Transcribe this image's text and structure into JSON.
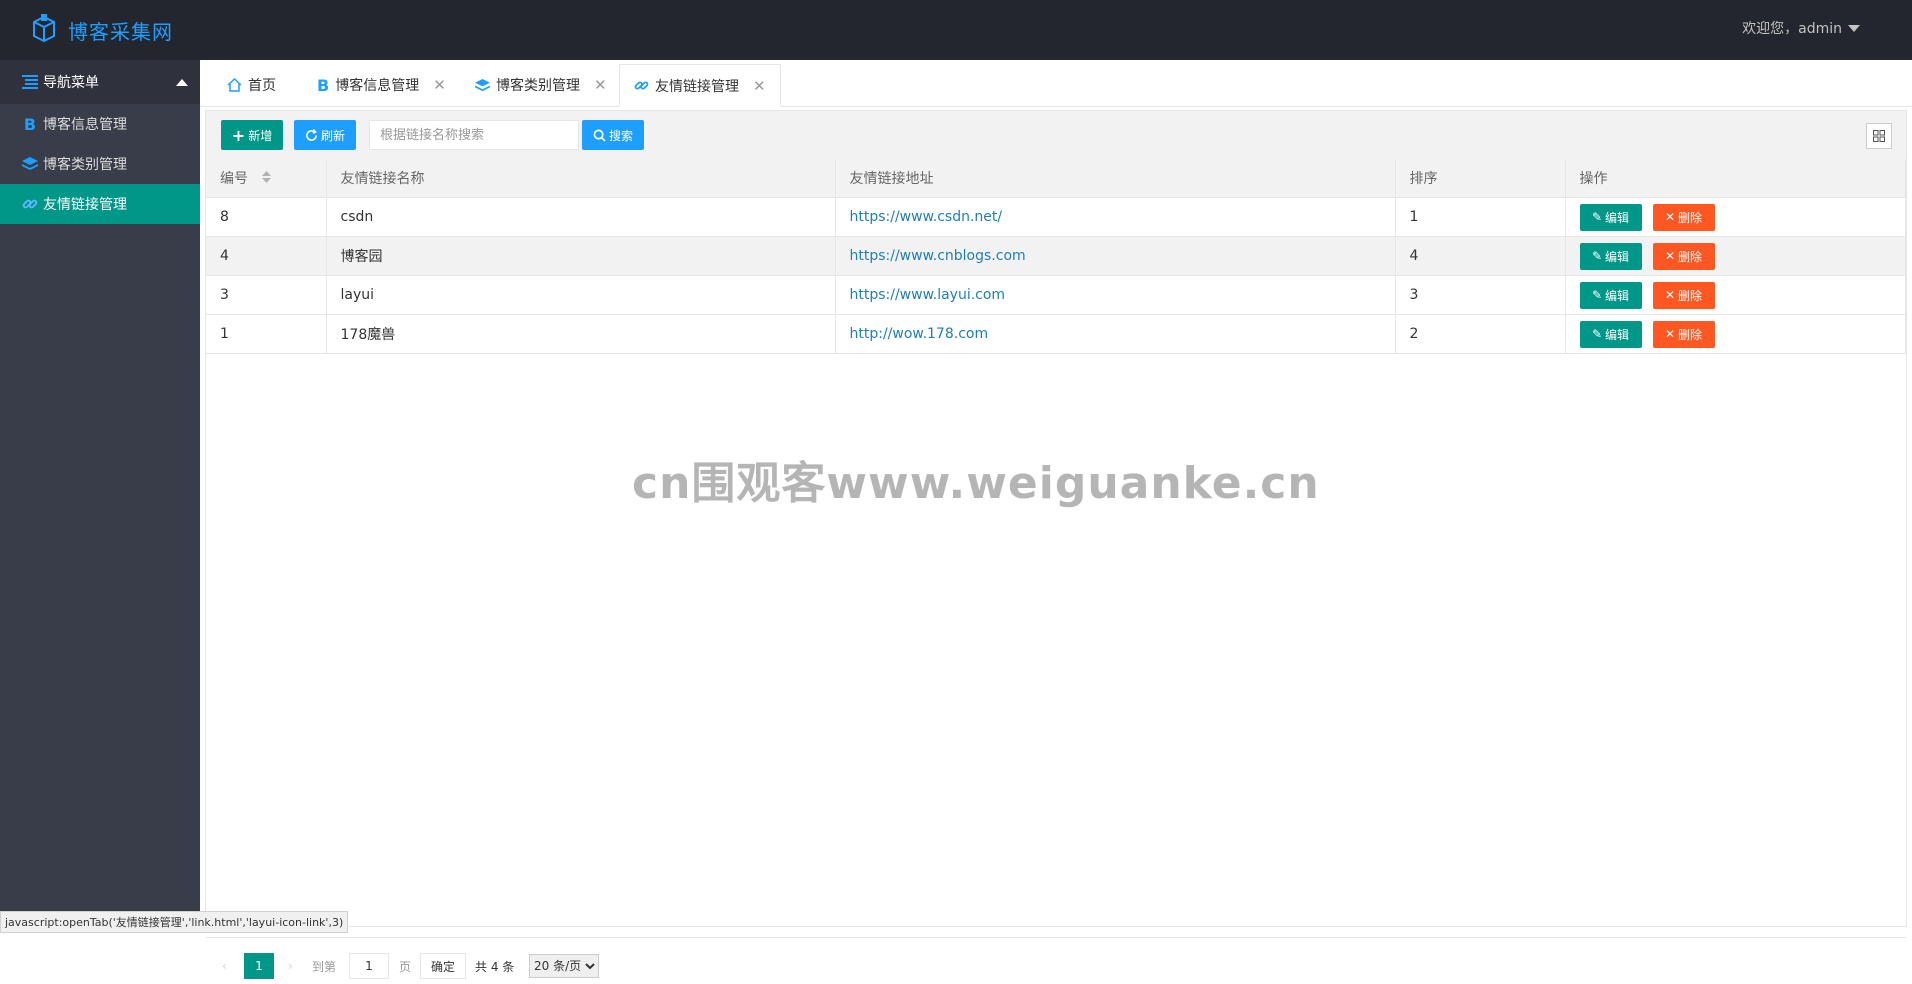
{
  "app": {
    "title": "博客采集网",
    "user_greeting": "欢迎您，admin"
  },
  "sidebar": {
    "header": "导航菜单",
    "items": [
      {
        "label": "博客信息管理",
        "icon": "b-icon"
      },
      {
        "label": "博客类别管理",
        "icon": "layers-icon"
      },
      {
        "label": "友情链接管理",
        "icon": "link-icon",
        "active": true
      }
    ]
  },
  "tabs": [
    {
      "label": "首页",
      "icon": "home-icon"
    },
    {
      "label": "博客信息管理",
      "icon": "b-icon",
      "closable": true
    },
    {
      "label": "博客类别管理",
      "icon": "layers-icon",
      "closable": true
    },
    {
      "label": "友情链接管理",
      "icon": "link-icon",
      "closable": true,
      "active": true
    }
  ],
  "toolbar": {
    "add_label": "新增",
    "refresh_label": "刷新",
    "search_placeholder": "根据链接名称搜索",
    "search_label": "搜索"
  },
  "table": {
    "headers": [
      "编号",
      "友情链接名称",
      "友情链接地址",
      "排序",
      "操作"
    ],
    "edit_label": "编辑",
    "delete_label": "删除",
    "rows": [
      {
        "id": "8",
        "name": "csdn",
        "url": "https://www.csdn.net/",
        "order": "1"
      },
      {
        "id": "4",
        "name": "博客园",
        "url": "https://www.cnblogs.com",
        "order": "4"
      },
      {
        "id": "3",
        "name": "layui",
        "url": "https://www.layui.com",
        "order": "3"
      },
      {
        "id": "1",
        "name": "178魔兽",
        "url": "http://wow.178.com",
        "order": "2"
      }
    ]
  },
  "watermark": "cn围观客www.weiguanke.cn",
  "pager": {
    "current_page": "1",
    "goto_label": "到第",
    "goto_value": "1",
    "page_suffix": "页",
    "confirm_label": "确定",
    "total_label": "共 4 条",
    "page_size": "20 条/页"
  },
  "status_bar": "javascript:openTab('友情链接管理','link.html','layui-icon-link',3)",
  "colors": {
    "header_bg": "#23262e",
    "sidebar_bg": "#393d49",
    "accent_green": "#009688",
    "accent_blue": "#1e9fff",
    "danger": "#ff5722"
  }
}
